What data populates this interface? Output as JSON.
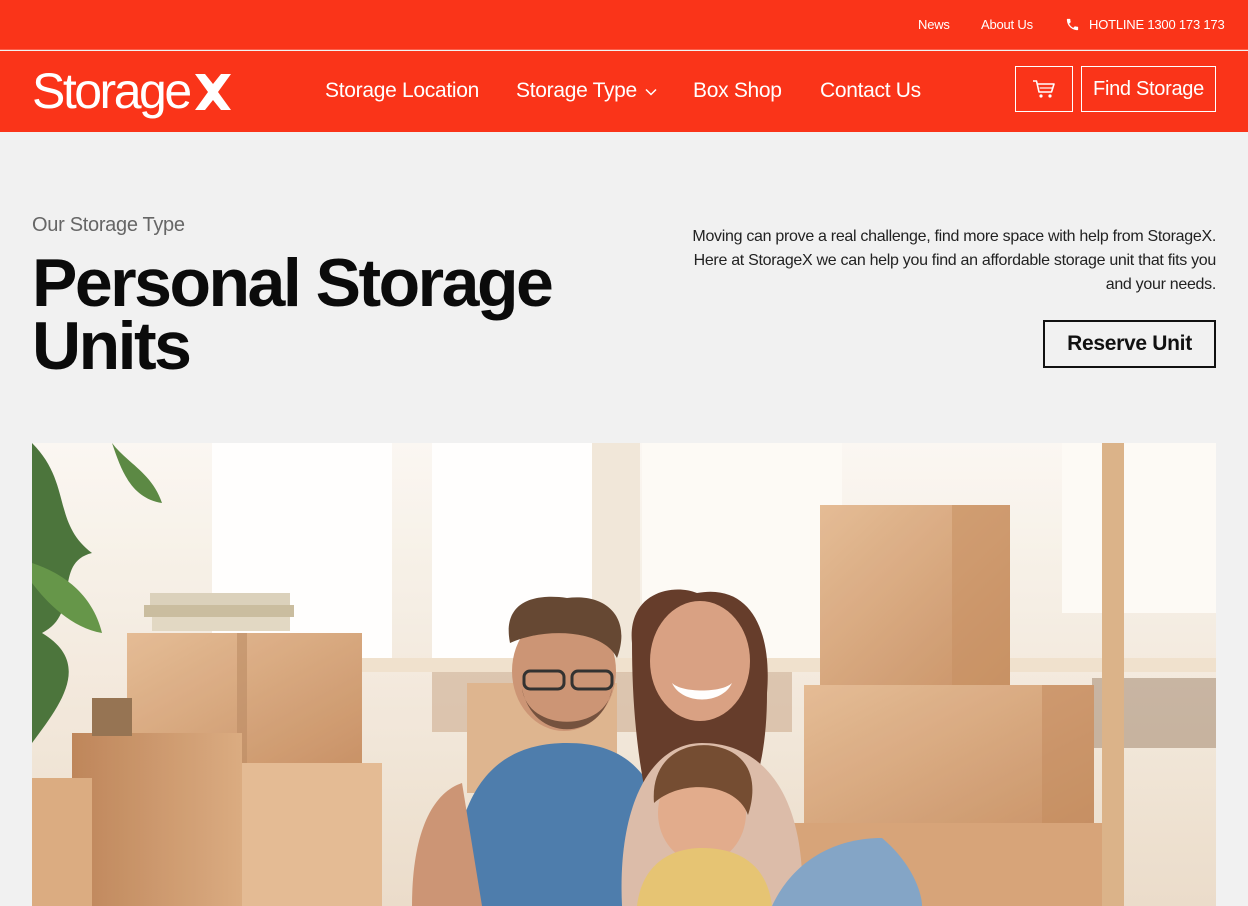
{
  "topbar": {
    "links": [
      "News",
      "About Us"
    ],
    "hotline": "HOTLINE 1300 173 173"
  },
  "brand": {
    "name": "Storage",
    "mark": "X"
  },
  "nav": {
    "items": [
      "Storage Location",
      "Storage Type",
      "Box Shop",
      "Contact Us"
    ],
    "cart_icon": "shopping-cart-icon",
    "find_storage": "Find Storage"
  },
  "hero": {
    "eyebrow": "Our Storage Type",
    "title": "Personal Storage Units",
    "description": "Moving can prove a real challenge, find more space with help from StorageX. Here at StorageX we can help you find an affordable storage unit that fits you and your needs.",
    "cta": "Reserve Unit",
    "image": "family-with-moving-boxes-photo"
  },
  "colors": {
    "brand_red": "#fa3419",
    "background": "#f1f1f1",
    "text": "#111111"
  }
}
